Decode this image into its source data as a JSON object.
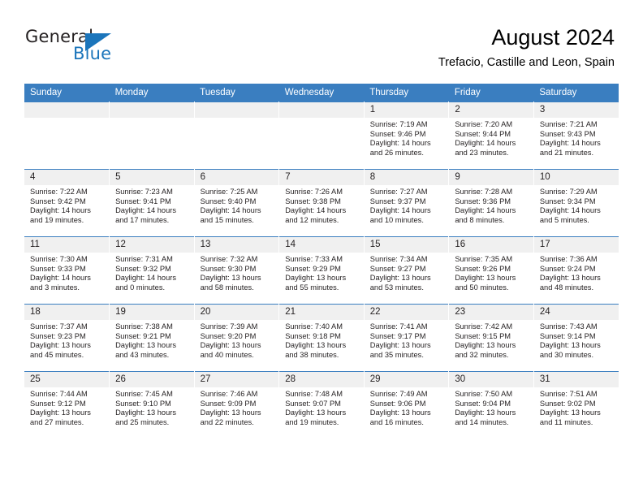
{
  "brand": {
    "name_part1": "General",
    "name_part2": "Blue",
    "accent_color": "#1b75bb"
  },
  "header": {
    "title": "August 2024",
    "subtitle": "Trefacio, Castille and Leon, Spain"
  },
  "theme": {
    "header_row_color": "#3a7ec0",
    "daynum_bg": "#f0f0f0"
  },
  "weekdays": [
    "Sunday",
    "Monday",
    "Tuesday",
    "Wednesday",
    "Thursday",
    "Friday",
    "Saturday"
  ],
  "weeks": [
    [
      {
        "day": "",
        "empty": true
      },
      {
        "day": "",
        "empty": true
      },
      {
        "day": "",
        "empty": true
      },
      {
        "day": "",
        "empty": true
      },
      {
        "day": "1",
        "sunrise": "Sunrise: 7:19 AM",
        "sunset": "Sunset: 9:46 PM",
        "daylight_line1": "Daylight: 14 hours",
        "daylight_line2": "and 26 minutes."
      },
      {
        "day": "2",
        "sunrise": "Sunrise: 7:20 AM",
        "sunset": "Sunset: 9:44 PM",
        "daylight_line1": "Daylight: 14 hours",
        "daylight_line2": "and 23 minutes."
      },
      {
        "day": "3",
        "sunrise": "Sunrise: 7:21 AM",
        "sunset": "Sunset: 9:43 PM",
        "daylight_line1": "Daylight: 14 hours",
        "daylight_line2": "and 21 minutes."
      }
    ],
    [
      {
        "day": "4",
        "sunrise": "Sunrise: 7:22 AM",
        "sunset": "Sunset: 9:42 PM",
        "daylight_line1": "Daylight: 14 hours",
        "daylight_line2": "and 19 minutes."
      },
      {
        "day": "5",
        "sunrise": "Sunrise: 7:23 AM",
        "sunset": "Sunset: 9:41 PM",
        "daylight_line1": "Daylight: 14 hours",
        "daylight_line2": "and 17 minutes."
      },
      {
        "day": "6",
        "sunrise": "Sunrise: 7:25 AM",
        "sunset": "Sunset: 9:40 PM",
        "daylight_line1": "Daylight: 14 hours",
        "daylight_line2": "and 15 minutes."
      },
      {
        "day": "7",
        "sunrise": "Sunrise: 7:26 AM",
        "sunset": "Sunset: 9:38 PM",
        "daylight_line1": "Daylight: 14 hours",
        "daylight_line2": "and 12 minutes."
      },
      {
        "day": "8",
        "sunrise": "Sunrise: 7:27 AM",
        "sunset": "Sunset: 9:37 PM",
        "daylight_line1": "Daylight: 14 hours",
        "daylight_line2": "and 10 minutes."
      },
      {
        "day": "9",
        "sunrise": "Sunrise: 7:28 AM",
        "sunset": "Sunset: 9:36 PM",
        "daylight_line1": "Daylight: 14 hours",
        "daylight_line2": "and 8 minutes."
      },
      {
        "day": "10",
        "sunrise": "Sunrise: 7:29 AM",
        "sunset": "Sunset: 9:34 PM",
        "daylight_line1": "Daylight: 14 hours",
        "daylight_line2": "and 5 minutes."
      }
    ],
    [
      {
        "day": "11",
        "sunrise": "Sunrise: 7:30 AM",
        "sunset": "Sunset: 9:33 PM",
        "daylight_line1": "Daylight: 14 hours",
        "daylight_line2": "and 3 minutes."
      },
      {
        "day": "12",
        "sunrise": "Sunrise: 7:31 AM",
        "sunset": "Sunset: 9:32 PM",
        "daylight_line1": "Daylight: 14 hours",
        "daylight_line2": "and 0 minutes."
      },
      {
        "day": "13",
        "sunrise": "Sunrise: 7:32 AM",
        "sunset": "Sunset: 9:30 PM",
        "daylight_line1": "Daylight: 13 hours",
        "daylight_line2": "and 58 minutes."
      },
      {
        "day": "14",
        "sunrise": "Sunrise: 7:33 AM",
        "sunset": "Sunset: 9:29 PM",
        "daylight_line1": "Daylight: 13 hours",
        "daylight_line2": "and 55 minutes."
      },
      {
        "day": "15",
        "sunrise": "Sunrise: 7:34 AM",
        "sunset": "Sunset: 9:27 PM",
        "daylight_line1": "Daylight: 13 hours",
        "daylight_line2": "and 53 minutes."
      },
      {
        "day": "16",
        "sunrise": "Sunrise: 7:35 AM",
        "sunset": "Sunset: 9:26 PM",
        "daylight_line1": "Daylight: 13 hours",
        "daylight_line2": "and 50 minutes."
      },
      {
        "day": "17",
        "sunrise": "Sunrise: 7:36 AM",
        "sunset": "Sunset: 9:24 PM",
        "daylight_line1": "Daylight: 13 hours",
        "daylight_line2": "and 48 minutes."
      }
    ],
    [
      {
        "day": "18",
        "sunrise": "Sunrise: 7:37 AM",
        "sunset": "Sunset: 9:23 PM",
        "daylight_line1": "Daylight: 13 hours",
        "daylight_line2": "and 45 minutes."
      },
      {
        "day": "19",
        "sunrise": "Sunrise: 7:38 AM",
        "sunset": "Sunset: 9:21 PM",
        "daylight_line1": "Daylight: 13 hours",
        "daylight_line2": "and 43 minutes."
      },
      {
        "day": "20",
        "sunrise": "Sunrise: 7:39 AM",
        "sunset": "Sunset: 9:20 PM",
        "daylight_line1": "Daylight: 13 hours",
        "daylight_line2": "and 40 minutes."
      },
      {
        "day": "21",
        "sunrise": "Sunrise: 7:40 AM",
        "sunset": "Sunset: 9:18 PM",
        "daylight_line1": "Daylight: 13 hours",
        "daylight_line2": "and 38 minutes."
      },
      {
        "day": "22",
        "sunrise": "Sunrise: 7:41 AM",
        "sunset": "Sunset: 9:17 PM",
        "daylight_line1": "Daylight: 13 hours",
        "daylight_line2": "and 35 minutes."
      },
      {
        "day": "23",
        "sunrise": "Sunrise: 7:42 AM",
        "sunset": "Sunset: 9:15 PM",
        "daylight_line1": "Daylight: 13 hours",
        "daylight_line2": "and 32 minutes."
      },
      {
        "day": "24",
        "sunrise": "Sunrise: 7:43 AM",
        "sunset": "Sunset: 9:14 PM",
        "daylight_line1": "Daylight: 13 hours",
        "daylight_line2": "and 30 minutes."
      }
    ],
    [
      {
        "day": "25",
        "sunrise": "Sunrise: 7:44 AM",
        "sunset": "Sunset: 9:12 PM",
        "daylight_line1": "Daylight: 13 hours",
        "daylight_line2": "and 27 minutes."
      },
      {
        "day": "26",
        "sunrise": "Sunrise: 7:45 AM",
        "sunset": "Sunset: 9:10 PM",
        "daylight_line1": "Daylight: 13 hours",
        "daylight_line2": "and 25 minutes."
      },
      {
        "day": "27",
        "sunrise": "Sunrise: 7:46 AM",
        "sunset": "Sunset: 9:09 PM",
        "daylight_line1": "Daylight: 13 hours",
        "daylight_line2": "and 22 minutes."
      },
      {
        "day": "28",
        "sunrise": "Sunrise: 7:48 AM",
        "sunset": "Sunset: 9:07 PM",
        "daylight_line1": "Daylight: 13 hours",
        "daylight_line2": "and 19 minutes."
      },
      {
        "day": "29",
        "sunrise": "Sunrise: 7:49 AM",
        "sunset": "Sunset: 9:06 PM",
        "daylight_line1": "Daylight: 13 hours",
        "daylight_line2": "and 16 minutes."
      },
      {
        "day": "30",
        "sunrise": "Sunrise: 7:50 AM",
        "sunset": "Sunset: 9:04 PM",
        "daylight_line1": "Daylight: 13 hours",
        "daylight_line2": "and 14 minutes."
      },
      {
        "day": "31",
        "sunrise": "Sunrise: 7:51 AM",
        "sunset": "Sunset: 9:02 PM",
        "daylight_line1": "Daylight: 13 hours",
        "daylight_line2": "and 11 minutes."
      }
    ]
  ]
}
